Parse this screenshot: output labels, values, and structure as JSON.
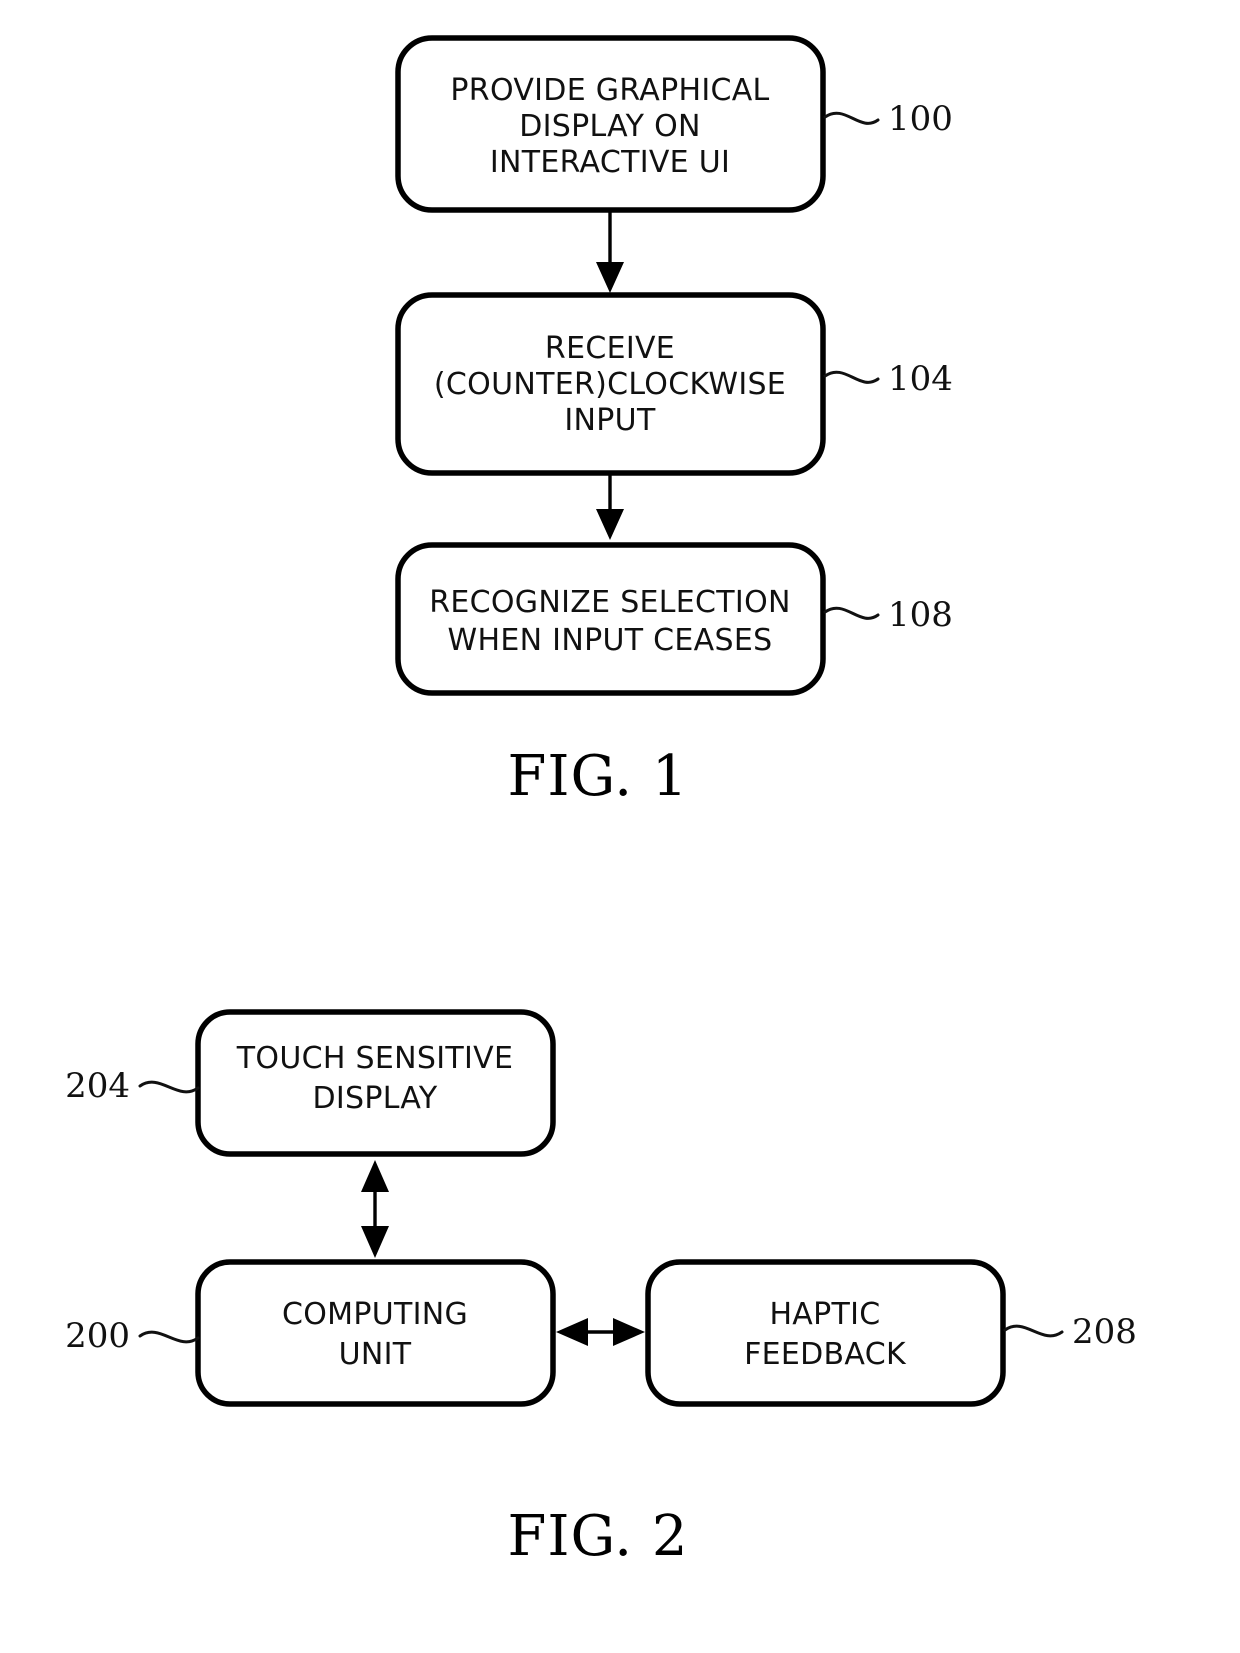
{
  "document": {
    "kind": "patent-drawing-sheet",
    "background_color": "#ffffff",
    "ink_color": "#000000"
  },
  "figures": [
    {
      "id": "fig1",
      "caption": "FIG. 1",
      "type": "flowchart",
      "steps": [
        {
          "ref": "100",
          "lines": [
            "PROVIDE GRAPHICAL",
            "DISPLAY ON",
            "INTERACTIVE UI"
          ],
          "ref_side": "right"
        },
        {
          "ref": "104",
          "lines": [
            "RECEIVE",
            "(COUNTER)CLOCKWISE",
            "INPUT"
          ],
          "ref_side": "right"
        },
        {
          "ref": "108",
          "lines": [
            "RECOGNIZE SELECTION",
            "WHEN INPUT CEASES"
          ],
          "ref_side": "right"
        }
      ],
      "connectors": [
        {
          "from": "100",
          "to": "104",
          "style": "single-arrow-down"
        },
        {
          "from": "104",
          "to": "108",
          "style": "single-arrow-down"
        }
      ]
    },
    {
      "id": "fig2",
      "caption": "FIG. 2",
      "type": "block-diagram",
      "blocks": [
        {
          "ref": "204",
          "lines": [
            "TOUCH SENSITIVE",
            "DISPLAY"
          ],
          "ref_side": "left"
        },
        {
          "ref": "200",
          "lines": [
            "COMPUTING",
            "UNIT"
          ],
          "ref_side": "left"
        },
        {
          "ref": "208",
          "lines": [
            "HAPTIC",
            "FEEDBACK"
          ],
          "ref_side": "right"
        }
      ],
      "connectors": [
        {
          "from": "204",
          "to": "200",
          "style": "double-arrow-vertical"
        },
        {
          "from": "200",
          "to": "208",
          "style": "double-arrow-horizontal"
        }
      ]
    }
  ]
}
